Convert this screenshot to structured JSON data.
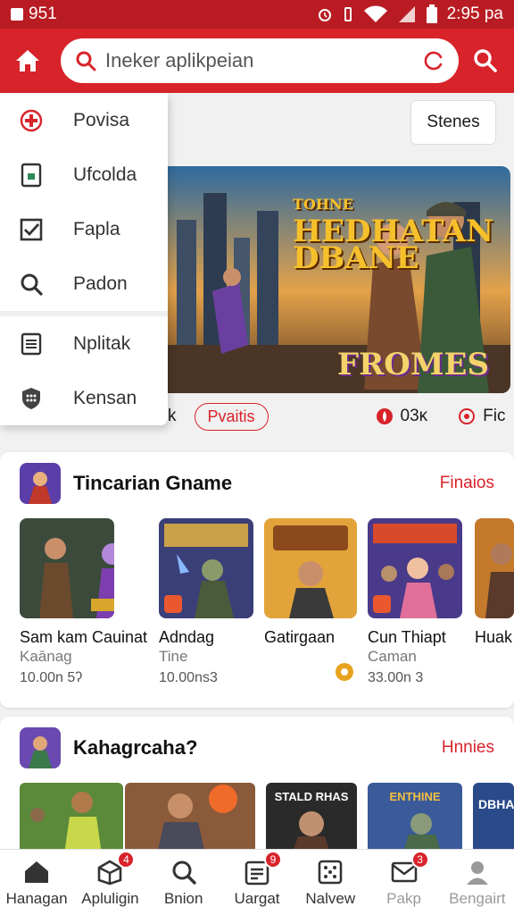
{
  "status_bar": {
    "left_text": "951",
    "time": "2:95 pa"
  },
  "search": {
    "placeholder": "Ineker aplikpeian"
  },
  "stores_button": "Stenes",
  "menu": {
    "items": [
      {
        "label": "Povisa",
        "icon": "first-aid-icon"
      },
      {
        "label": "Ufcolda",
        "icon": "document-lock-icon"
      },
      {
        "label": "Fapla",
        "icon": "checkbox-icon"
      },
      {
        "label": "Padon",
        "icon": "search-icon"
      },
      {
        "label": "Nplitak",
        "icon": "list-icon"
      },
      {
        "label": "Kensan",
        "icon": "shield-grid-icon"
      }
    ]
  },
  "banner": {
    "title_small": "TOHNE",
    "title": "HEDHATAN DBANE",
    "logo": "FROMES",
    "row_prefix": "k",
    "pill": "Pvaitis",
    "stat1": "03κ",
    "stat2": "Fic"
  },
  "section1": {
    "title": "Tincarian Gname",
    "more": "Finaios",
    "cards": [
      {
        "title": "Sam kam Cauinat",
        "subtitle": "Kaānaɡ",
        "meta": "10.00n 5ʔ"
      },
      {
        "title": "Adndaɡ",
        "subtitle": "Tine",
        "meta": "10.00ns3"
      },
      {
        "title": "Gatirgaan",
        "subtitle": "",
        "meta": ""
      },
      {
        "title": "Cun Thiapt",
        "subtitle": "Caman",
        "meta": "33.00n 3"
      },
      {
        "title": "Huak",
        "subtitle": "",
        "meta": ""
      }
    ]
  },
  "section2": {
    "title": "Kahagrcaha?",
    "more": "Hnnies",
    "thumbs": [
      "",
      "",
      "STALD RHAS",
      "ENTHINE",
      "DBHA"
    ]
  },
  "bottom_nav": [
    {
      "label": "Hanagan",
      "icon": "home-icon",
      "badge": ""
    },
    {
      "label": "Apluligin",
      "icon": "apps-box-icon",
      "badge": "4"
    },
    {
      "label": "Bnion",
      "icon": "search-icon",
      "badge": ""
    },
    {
      "label": "Uargat",
      "icon": "updates-icon",
      "badge": "9"
    },
    {
      "label": "Nalvew",
      "icon": "grid-icon",
      "badge": ""
    },
    {
      "label": "Pakp",
      "icon": "mail-icon",
      "badge": "3"
    },
    {
      "label": "Bengairt",
      "icon": "account-icon",
      "badge": ""
    }
  ],
  "colors": {
    "brand": "#d8232a",
    "status_bar": "#b81c22",
    "accent_gold": "#e8a21d"
  }
}
